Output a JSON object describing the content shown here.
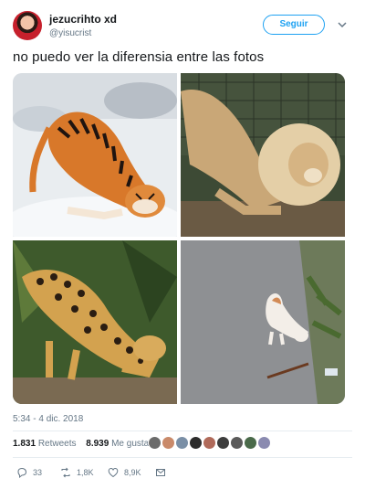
{
  "user": {
    "display_name": "jezucrihto xd",
    "handle": "@yisucrist",
    "avatar_icon": "avatar-icon"
  },
  "follow_label": "Seguir",
  "tweet": {
    "text": "no puedo ver la diferensia entre las fotos"
  },
  "photos": [
    {
      "subject": "tiger-stretching-in-snow"
    },
    {
      "subject": "lion-stretching"
    },
    {
      "subject": "jaguar-stretching"
    },
    {
      "subject": "cat-stretching-on-path"
    }
  ],
  "timestamp": "5:34 - 4 dic. 2018",
  "stats": {
    "retweets_count": "1.831",
    "retweets_label": "Retweets",
    "likes_count": "8.939",
    "likes_label": "Me gusta"
  },
  "likers_colors": [
    "#6b6b6b",
    "#c98a6a",
    "#7a8fa6",
    "#2c2c2c",
    "#b06a5a",
    "#3d3d3d",
    "#5a5a5a",
    "#4a6a4a",
    "#8a8ab0"
  ],
  "actions": {
    "reply_count": "33",
    "retweet_count": "1,8K",
    "like_count": "8,9K"
  },
  "colors": {
    "accent": "#1da1f2",
    "text": "#14171a",
    "secondary": "#657786"
  }
}
